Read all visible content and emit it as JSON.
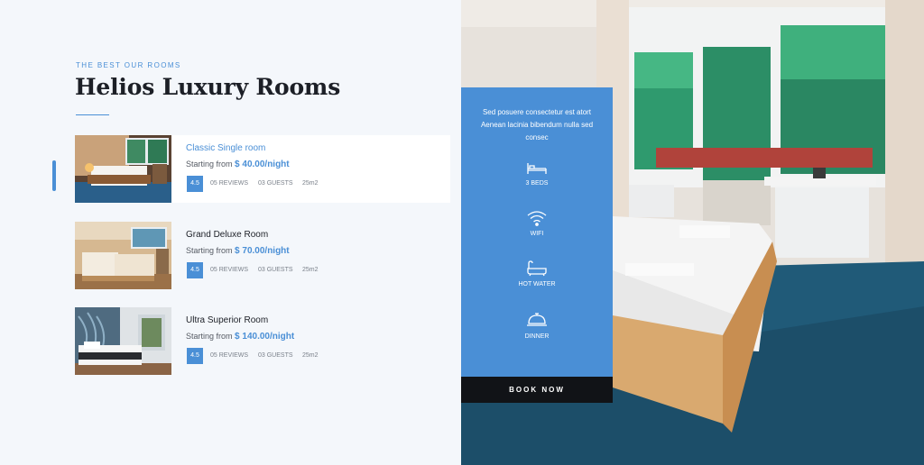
{
  "section": {
    "eyebrow": "THE BEST OUR ROOMS",
    "title": "Helios Luxury Rooms"
  },
  "rooms": [
    {
      "name": "Classic Single room",
      "price_prefix": "Starting from",
      "price": "$ 40.00/night",
      "rating": "4.5",
      "reviews": "05 REVIEWS",
      "guests": "03 GUESTS",
      "size": "25m2",
      "active": true
    },
    {
      "name": "Grand Deluxe Room",
      "price_prefix": "Starting from",
      "price": "$ 70.00/night",
      "rating": "4.5",
      "reviews": "05 REVIEWS",
      "guests": "03 GUESTS",
      "size": "25m2",
      "active": false
    },
    {
      "name": "Ultra Superior Room",
      "price_prefix": "Starting from",
      "price": "$ 140.00/night",
      "rating": "4.5",
      "reviews": "05 REVIEWS",
      "guests": "03 GUESTS",
      "size": "25m2",
      "active": false
    }
  ],
  "panel": {
    "description": "Sed posuere consectetur est atort Aenean lacinia bibendum nulla sed consec",
    "features": [
      {
        "icon": "bed-icon",
        "label": "3 BEDS"
      },
      {
        "icon": "wifi-icon",
        "label": "WIFI"
      },
      {
        "icon": "bathtub-icon",
        "label": "HOT WATER"
      },
      {
        "icon": "cloche-icon",
        "label": "DINNER"
      }
    ],
    "cta": "BOOK NOW"
  },
  "colors": {
    "accent": "#4a8fd6",
    "dark": "#111317",
    "background": "#f4f7fb"
  }
}
